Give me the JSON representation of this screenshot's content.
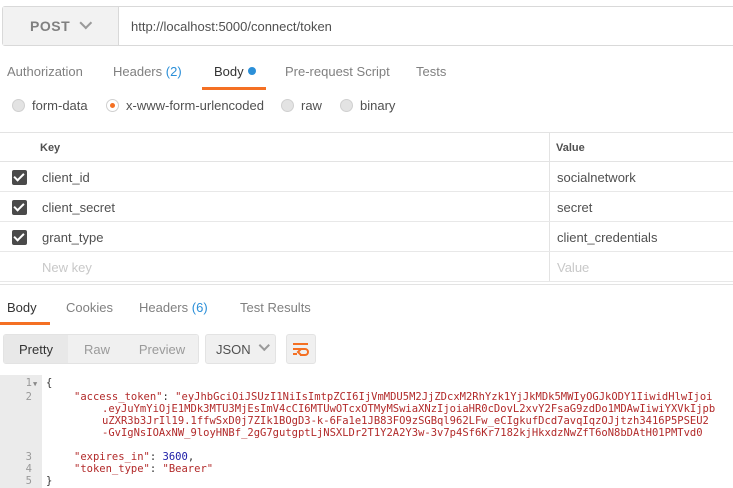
{
  "request": {
    "method": "POST",
    "url": "http://localhost:5000/connect/token"
  },
  "request_tabs": [
    {
      "label": "Authorization"
    },
    {
      "label": "Headers",
      "count": "(2)"
    },
    {
      "label": "Body",
      "active": true
    },
    {
      "label": "Pre-request Script"
    },
    {
      "label": "Tests"
    }
  ],
  "body_types": [
    {
      "label": "form-data",
      "selected": false
    },
    {
      "label": "x-www-form-urlencoded",
      "selected": true
    },
    {
      "label": "raw",
      "selected": false
    },
    {
      "label": "binary",
      "selected": false
    }
  ],
  "params_table": {
    "headers": {
      "key": "Key",
      "value": "Value"
    },
    "rows": [
      {
        "checked": true,
        "key": "client_id",
        "value": "socialnetwork"
      },
      {
        "checked": true,
        "key": "client_secret",
        "value": "secret"
      },
      {
        "checked": true,
        "key": "grant_type",
        "value": "client_credentials"
      }
    ],
    "placeholders": {
      "key": "New key",
      "value": "Value"
    }
  },
  "response_tabs": [
    {
      "label": "Body",
      "active": true
    },
    {
      "label": "Cookies"
    },
    {
      "label": "Headers",
      "count": "(6)"
    },
    {
      "label": "Test Results"
    }
  ],
  "view_modes": [
    "Pretty",
    "Raw",
    "Preview"
  ],
  "active_view": "Pretty",
  "format": "JSON",
  "icons": {
    "wrap": "wrap-lines-icon",
    "method_dropdown": "chevron-down-icon",
    "format_dropdown": "chevron-down-icon"
  },
  "colors": {
    "accent": "#f47023",
    "badge": "#2b8fd8"
  },
  "code_lines": {
    "l1": "{",
    "l2_key": "\"access_token\"",
    "l2_val": "\"eyJhbGciOiJSUzI1NiIsImtpZCI6IjVmMDU5M2JjZDcxM2RhYzk1YjJkMDk5MWIyOGJkODY1IiwidHlwIjoi",
    "l2_c1": ".eyJuYmYiOjE1MDk3MTU3MjEsImV4cCI6MTUwOTcxOTMyMSwiaXNzIjoiaHR0cDovL2xvY2FsaG9zdDo1MDAwIiwiYXVkIjpb",
    "l2_c2": "uZXR3b3JrIl19.1ffwSxD0j7ZIk1BOgD3-k-6Fa1e1JB83FO9zSGBql962LFw_eCIgkufDcd7avqIqzOJjtzh3416P5PSEU2",
    "l2_c3": "-GvIgNsIOAxNW_9loyHNBf_2gG7gutgptLjNSXLDr2T1Y2A2Y3w-3v7p4Sf6Kr7182kjHkxdzNwZfT6oN8bDAtH01PMTvd0",
    "l3_key": "\"expires_in\"",
    "l3_val": "3600",
    "l4_key": "\"token_type\"",
    "l4_val": "\"Bearer\"",
    "l5": "}"
  },
  "line_numbers": [
    "1",
    "2",
    "3",
    "4",
    "5"
  ]
}
